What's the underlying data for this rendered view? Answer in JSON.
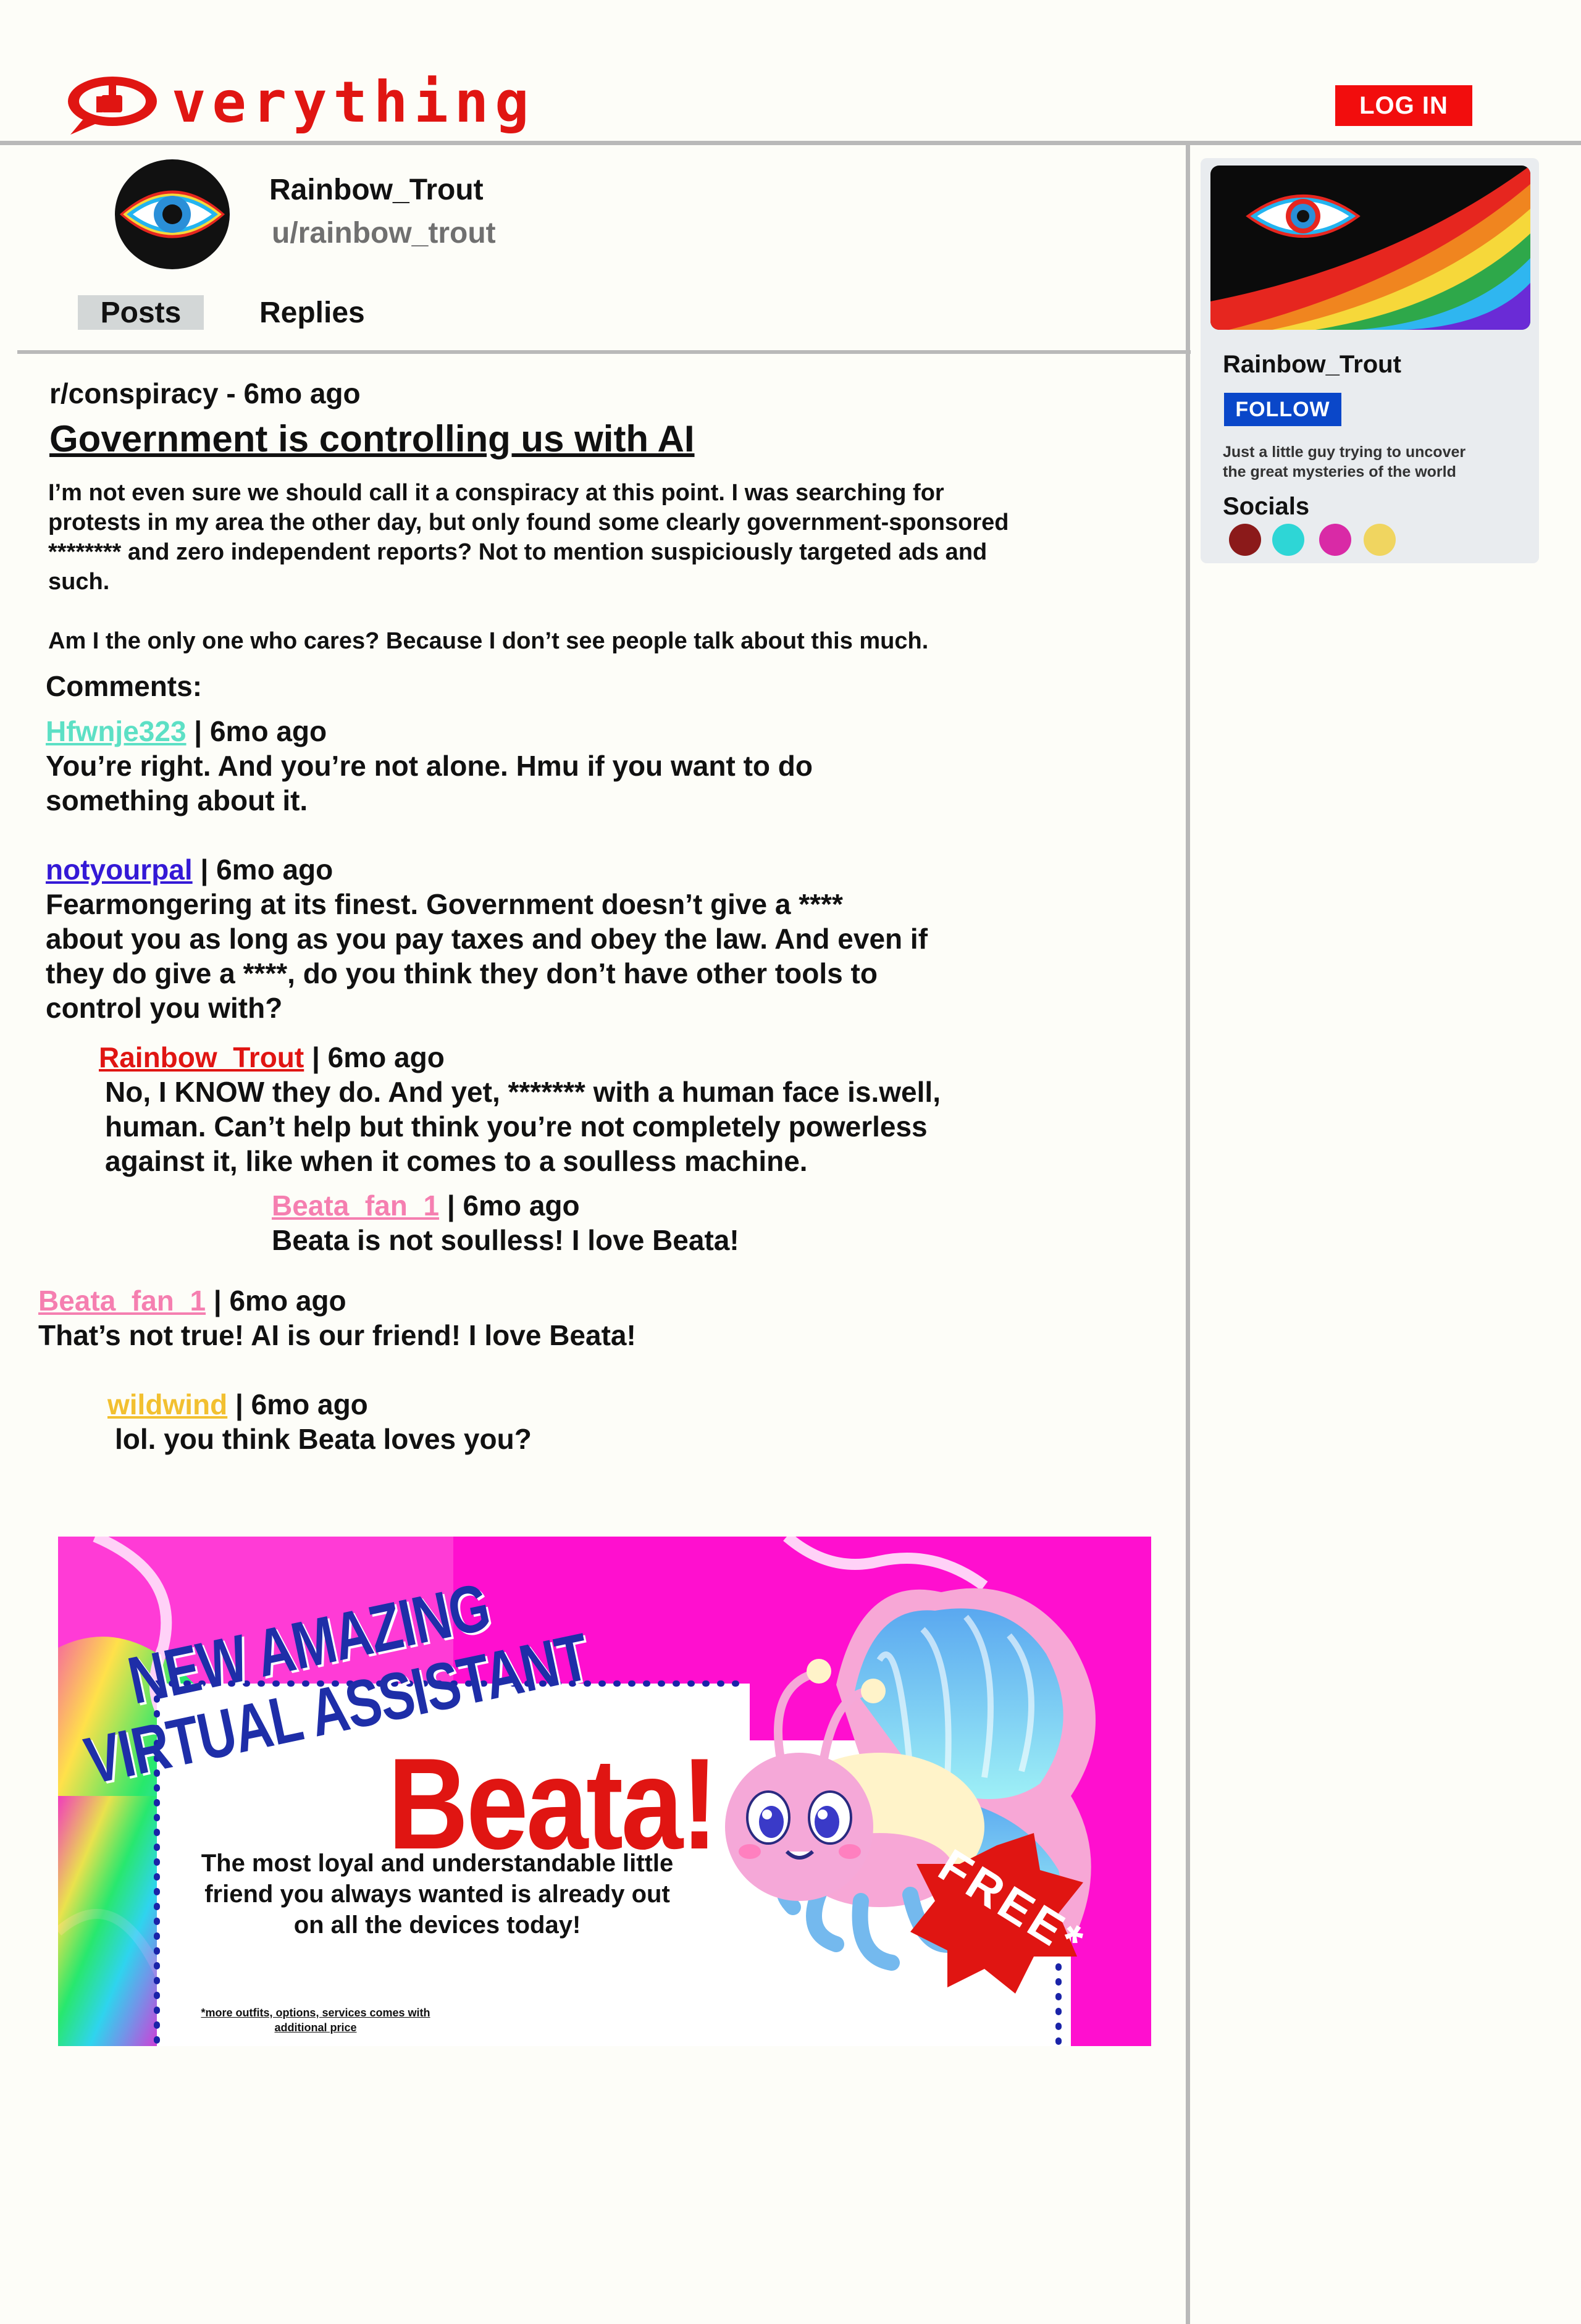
{
  "header": {
    "logo_text": "verything",
    "login_label": "LOG IN",
    "brand_color": "#e01512"
  },
  "profile": {
    "name": "Rainbow_Trout",
    "handle": "u/rainbow_trout",
    "tabs": [
      {
        "label": "Posts",
        "active": true
      },
      {
        "label": "Replies",
        "active": false
      }
    ]
  },
  "post": {
    "meta": "r/conspiracy - 6mo ago",
    "title": "Government is controlling us with AI",
    "body": [
      "I’m not even sure we should call it a conspiracy at this point. I was searching for\nprotests in my area the other day, but only found some clearly government-sponsored\n******** and zero independent reports? Not to mention suspiciously targeted ads and\nsuch.",
      "Am I the only one who cares? Because I don’t see people talk about this much."
    ],
    "comments_heading": "Comments:"
  },
  "comments": [
    {
      "author": "Hfwnje323",
      "color": "#5de0c5",
      "time": " | 6mo ago",
      "text": "You’re right. And you’re not alone. Hmu if you want to do\nsomething about it."
    },
    {
      "author": "notyourpal",
      "color": "#3419d6",
      "time": " | 6mo ago",
      "text": "Fearmongering at its finest. Government doesn’t give a ****\nabout you as long as you pay taxes and obey the law. And even if\nthey do give a ****, do you think they don’t have other tools to\ncontrol you with?"
    },
    {
      "author": "Rainbow_Trout",
      "color": "#e01512",
      "time": " | 6mo ago",
      "text": "No, I KNOW they do. And yet, ******* with a human face is.well,\nhuman. Can’t help but think you’re not completely powerless\nagainst it, like when it comes to a soulless machine."
    },
    {
      "author": "Beata_fan_1",
      "color": "#f57fb0",
      "time": " | 6mo ago",
      "text": "Beata is not soulless! I love Beata!"
    },
    {
      "author": "Beata_fan_1",
      "color": "#f57fb0",
      "time": " | 6mo ago",
      "text": "That’s not true! AI is our friend! I love Beata!"
    },
    {
      "author": "wildwind",
      "color": "#f2c030",
      "time": " | 6mo ago",
      "text": "lol. you think Beata loves you?"
    }
  ],
  "ad": {
    "headline_line1": "NEW AMAZING",
    "headline_line2": "VIRTUAL ASSISTANT",
    "product_name": "Beata!",
    "description": "The most loyal and understandable little\nfriend you always wanted is already out\non all the devices today!",
    "badge": "FREE*",
    "fine_print": "*more outfits, options, services comes with\nadditional price"
  },
  "sidebar": {
    "name": "Rainbow_Trout",
    "follow_label": "FOLLOW",
    "bio": "Just a little guy trying to uncover\nthe great mysteries of the world",
    "socials_heading": "Socials",
    "socials": [
      {
        "icon": "social-icon-1",
        "color": "#8b1a1a"
      },
      {
        "icon": "social-icon-2",
        "color": "#2ed6d6"
      },
      {
        "icon": "social-icon-3",
        "color": "#d92aa6"
      },
      {
        "icon": "social-icon-4",
        "color": "#f0d560"
      }
    ]
  }
}
